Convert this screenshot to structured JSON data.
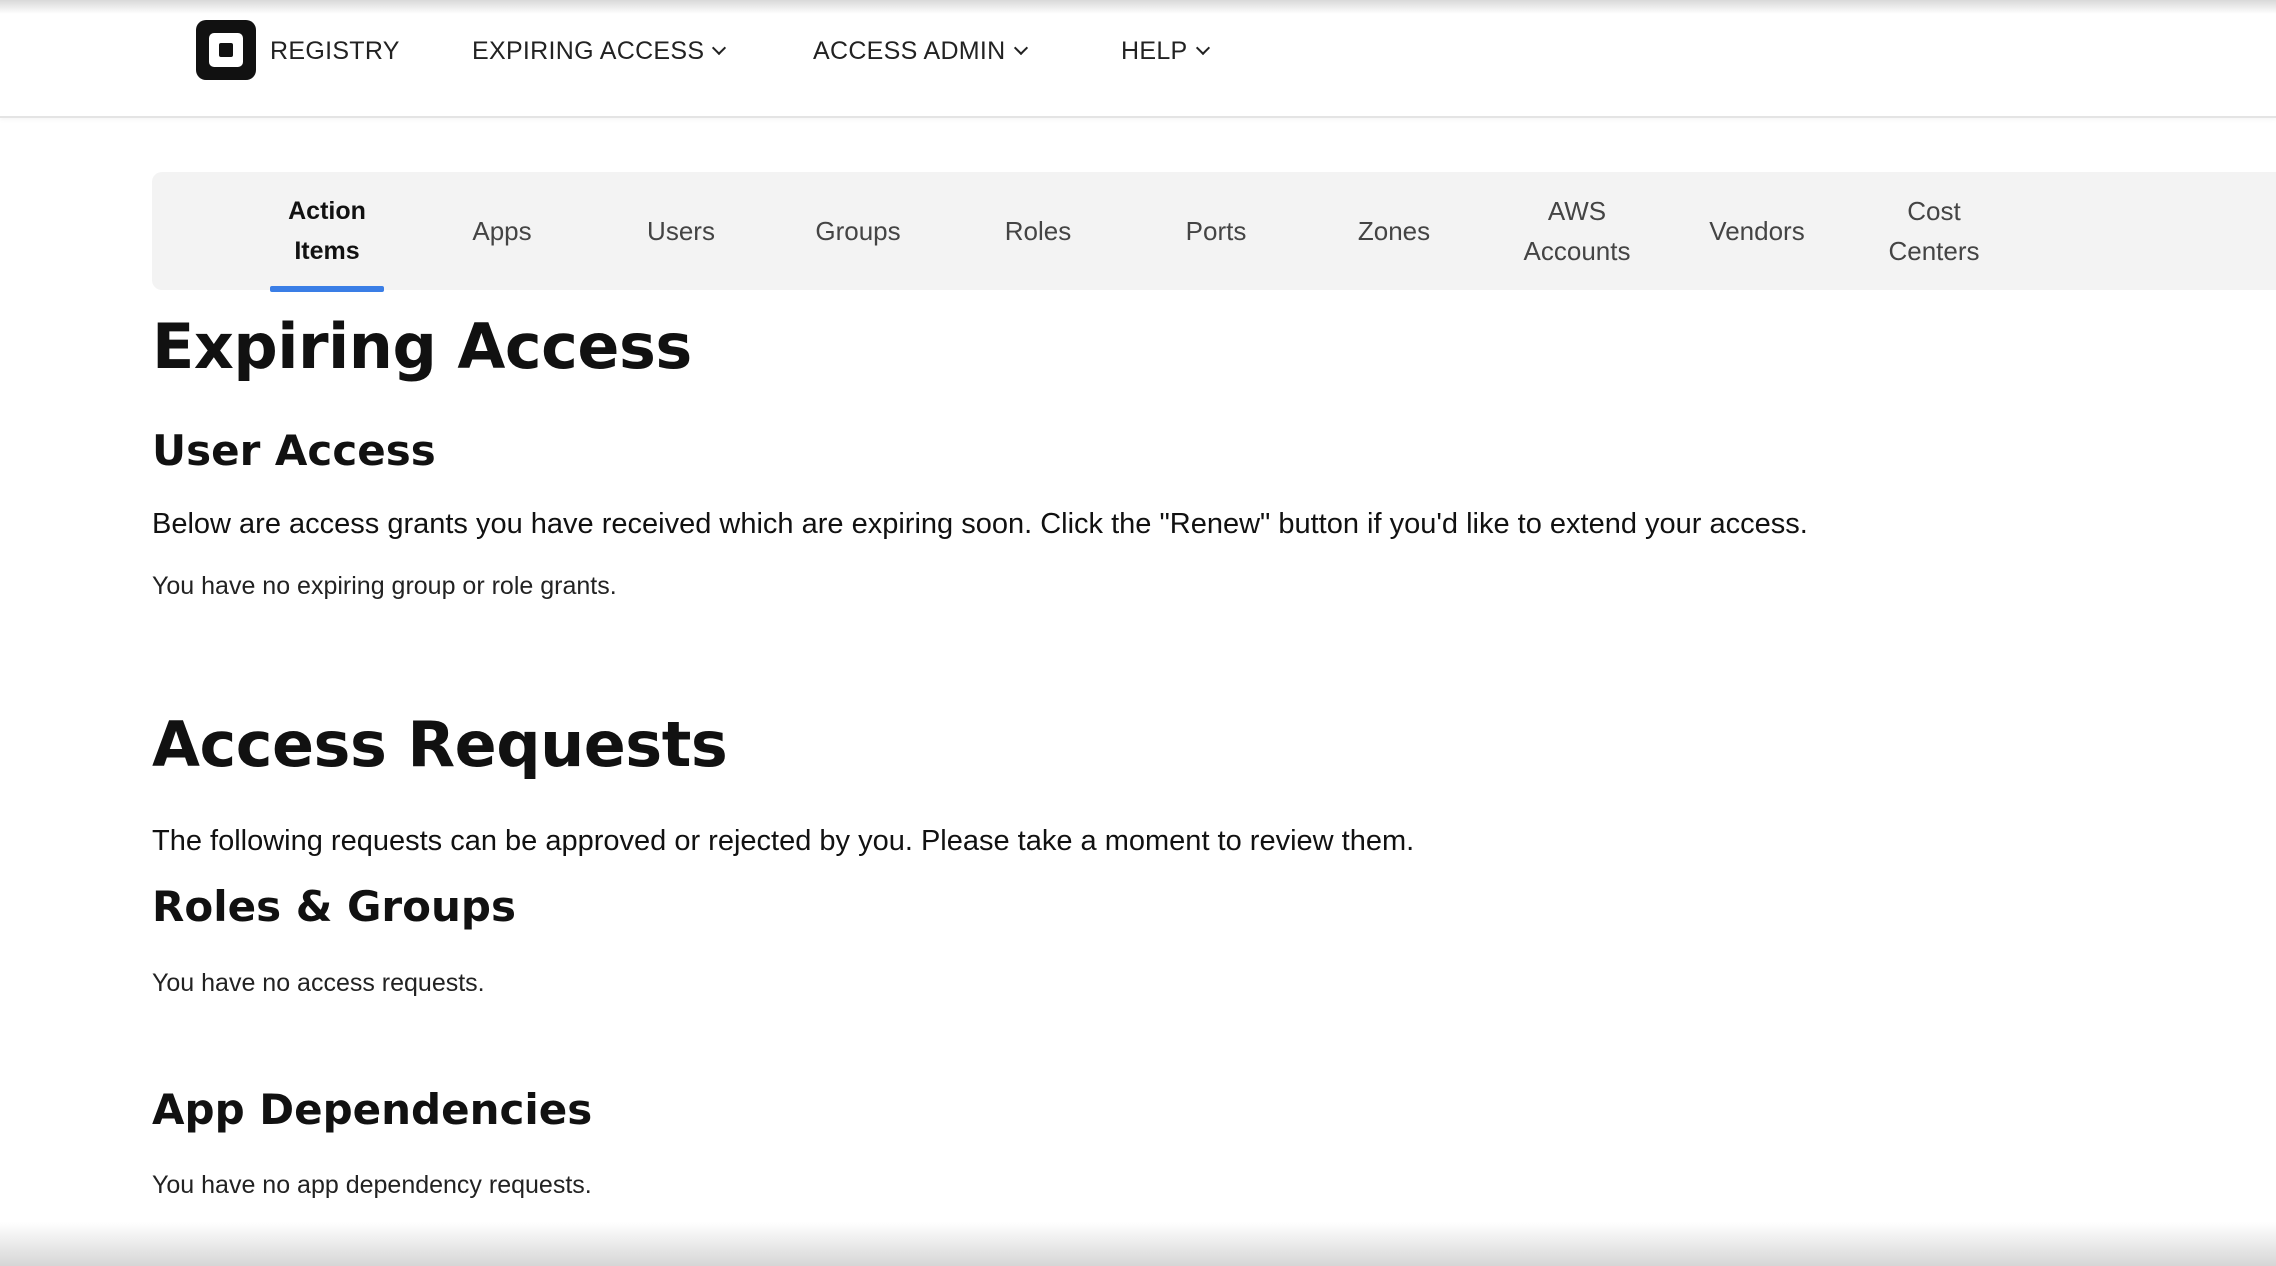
{
  "brand": {
    "name": "REGISTRY"
  },
  "topnav": {
    "items": [
      {
        "label": "EXPIRING ACCESS",
        "dropdown": true
      },
      {
        "label": "ACCESS ADMIN",
        "dropdown": true
      },
      {
        "label": "HELP",
        "dropdown": true
      }
    ]
  },
  "subnav": {
    "active_tab": "Action Items",
    "accent_color": "#3a7ee6",
    "tabs": [
      {
        "line1": "Action",
        "line2": "Items"
      },
      {
        "line1": "Apps",
        "line2": ""
      },
      {
        "line1": "Users",
        "line2": ""
      },
      {
        "line1": "Groups",
        "line2": ""
      },
      {
        "line1": "Roles",
        "line2": ""
      },
      {
        "line1": "Ports",
        "line2": ""
      },
      {
        "line1": "Zones",
        "line2": ""
      },
      {
        "line1": "AWS",
        "line2": "Accounts"
      },
      {
        "line1": "Vendors",
        "line2": ""
      },
      {
        "line1": "Cost",
        "line2": "Centers"
      }
    ]
  },
  "expiring": {
    "title": "Expiring Access",
    "user_access_heading": "User Access",
    "description": "Below are access grants you have received which are expiring soon. Click the \"Renew\" button if you'd like to extend your access.",
    "empty_message": "You have no expiring group or role grants."
  },
  "requests": {
    "title": "Access Requests",
    "description": "The following requests can be approved or rejected by you. Please take a moment to review them.",
    "roles_groups_heading": "Roles & Groups",
    "roles_groups_empty": "You have no access requests.",
    "app_deps_heading": "App Dependencies",
    "app_deps_empty": "You have no app dependency requests."
  }
}
